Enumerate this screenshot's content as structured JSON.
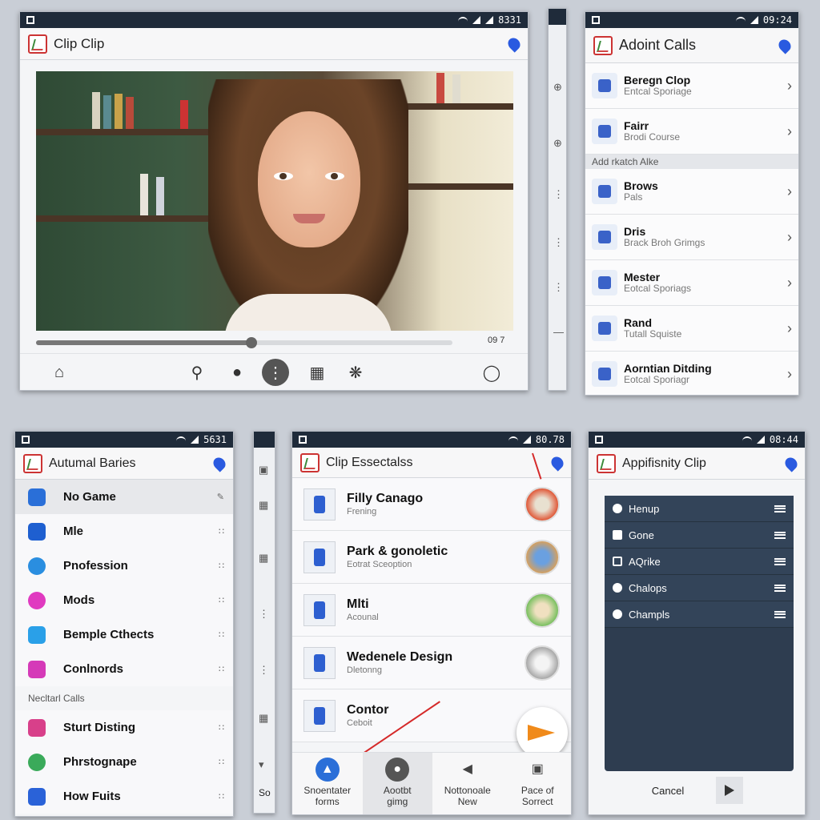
{
  "panel_video": {
    "status_time": "8331",
    "title": "Clip Clip",
    "time_label": "09 7"
  },
  "panel_calls": {
    "status_time": "09:24",
    "title": "Adoint Calls",
    "section": "Add rkatch Alke",
    "rows": [
      {
        "title": "Beregn Clop",
        "sub": "Entcal Sporiage"
      },
      {
        "title": "Fairr",
        "sub": "Brodi Course"
      },
      {
        "title": "Brows",
        "sub": "Pals"
      },
      {
        "title": "Dris",
        "sub": "Brack Broh Grimgs"
      },
      {
        "title": "Mester",
        "sub": "Eotcal Sporiags"
      },
      {
        "title": "Rand",
        "sub": "Tutall Squiste"
      },
      {
        "title": "Aorntian Ditding",
        "sub": "Eotcal Sporiagr"
      }
    ]
  },
  "panel_games": {
    "status_time": "5631",
    "title": "Autumal Baries",
    "section": "Necltarl Calls",
    "items_top": [
      {
        "label": "No Game",
        "color": "#2a6fd8"
      },
      {
        "label": "Mle",
        "color": "#1e5fd0"
      },
      {
        "label": "Pnofession",
        "color": "#2a8ee0"
      },
      {
        "label": "Mods",
        "color": "#e03ac0"
      },
      {
        "label": "Bemple Cthects",
        "color": "#2aa0e8"
      },
      {
        "label": "Conlnords",
        "color": "#d53ab8"
      }
    ],
    "items_bottom": [
      {
        "label": "Sturt Disting",
        "color": "#d8408a"
      },
      {
        "label": "Phrstognape",
        "color": "#3aaa5a"
      },
      {
        "label": "How Fuits",
        "color": "#2a62d8"
      }
    ]
  },
  "panel_essentials": {
    "status_time": "80.78",
    "title": "Clip Essectalss",
    "rows": [
      {
        "title": "Filly Canago",
        "sub": "Frening",
        "thumb": "#e05a3a"
      },
      {
        "title": "Park & gonoletic",
        "sub": "Eotrat Sceoption",
        "thumb": "#d4a060"
      },
      {
        "title": "Mlti",
        "sub": "Acounal",
        "thumb": "#7ac060"
      },
      {
        "title": "Wedenele Design",
        "sub": "Dletonng",
        "thumb": "#b8b8b8"
      },
      {
        "title": "Contor",
        "sub": "Ceboit",
        "thumb": "#ffffff"
      }
    ],
    "nav": [
      {
        "label": "Snoentater",
        "sub": "forms"
      },
      {
        "label": "Aootbt",
        "sub": "gimg"
      },
      {
        "label": "Nottonoale",
        "sub": "New"
      },
      {
        "label": "Pace of",
        "sub": "Sorrect"
      }
    ]
  },
  "panel_affinity": {
    "status_time": "08:44",
    "title": "Appifisnity Clip",
    "items": [
      "Henup",
      "Gone",
      "AQrike",
      "Chalops",
      "Champls"
    ],
    "cancel": "Cancel"
  },
  "strips": {
    "left_label": "So"
  }
}
